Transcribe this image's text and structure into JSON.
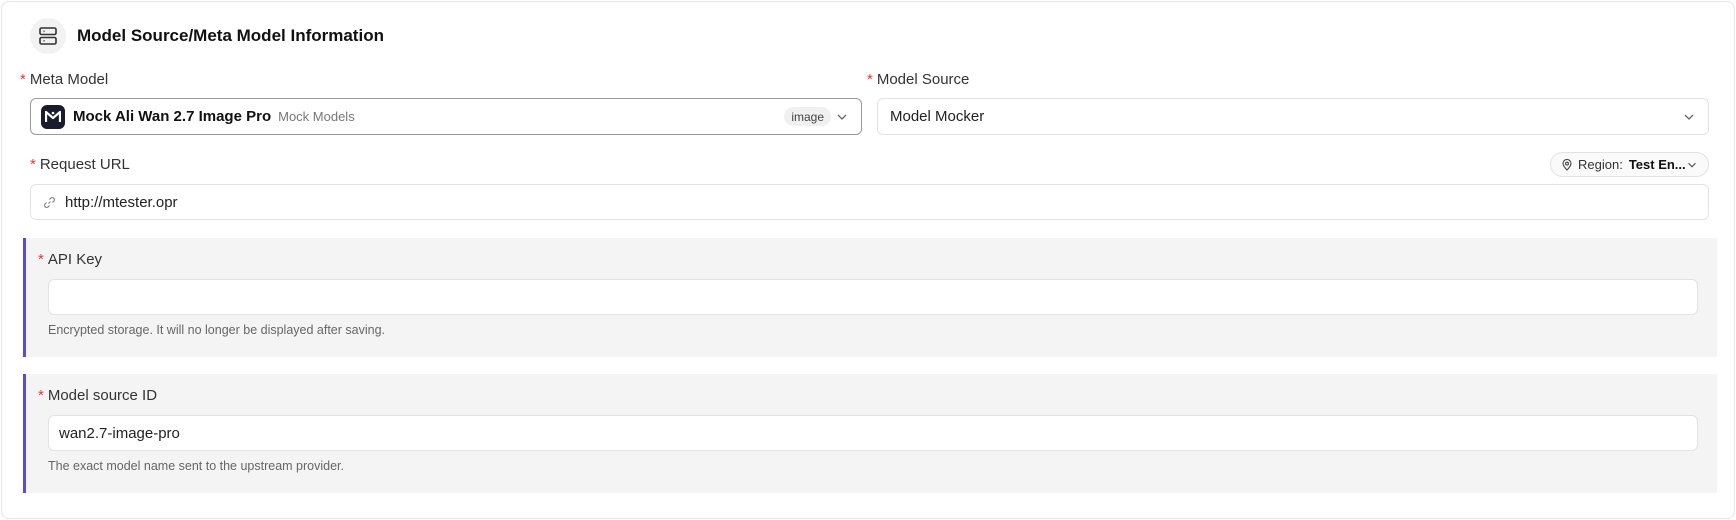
{
  "header": {
    "title": "Model Source/Meta Model Information",
    "icon": "server-icon"
  },
  "meta_model": {
    "label": "Meta Model",
    "required_mark": "*",
    "selected_name": "Mock Ali Wan 2.7 Image Pro",
    "selected_provider": "Mock Models",
    "badge": "image"
  },
  "model_source": {
    "label": "Model Source",
    "required_mark": "*",
    "selected": "Model Mocker"
  },
  "request_url": {
    "label": "Request URL",
    "required_mark": "*",
    "value": "http://mtester.opr",
    "region_label": "Region:",
    "region_value": "Test En..."
  },
  "api_key": {
    "label": "API Key",
    "required_mark": "*",
    "value": "",
    "hint": "Encrypted storage. It will no longer be displayed after saving."
  },
  "model_source_id": {
    "label": "Model source ID",
    "required_mark": "*",
    "value": "wan2.7-image-pro",
    "hint": "The exact model name sent to the upstream provider."
  },
  "colors": {
    "accent": "#5b4fc9",
    "required": "#e53935"
  }
}
